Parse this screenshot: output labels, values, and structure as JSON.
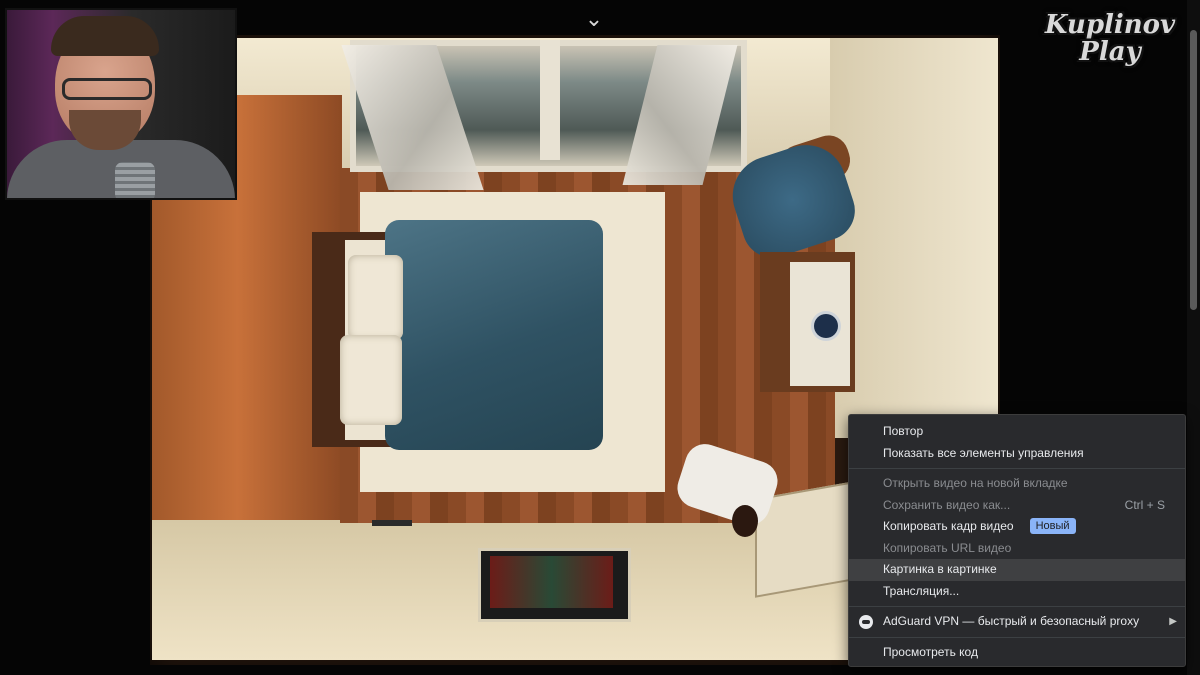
{
  "video": {
    "collapse_icon": "chevron-down-icon",
    "collapse_glyph": "⌄"
  },
  "webcam": {
    "description": "streamer-webcam"
  },
  "logo": {
    "line1": "Kuplinov",
    "line2": "Play"
  },
  "context_menu": {
    "items": [
      {
        "label": "Повтор",
        "enabled": true
      },
      {
        "label": "Показать все элементы управления",
        "enabled": true
      },
      {
        "label": "Открыть видео на новой вкладке",
        "enabled": false
      },
      {
        "label": "Сохранить видео как...",
        "shortcut": "Ctrl + S",
        "enabled": false
      },
      {
        "label": "Копировать кадр видео",
        "badge": "Новый",
        "enabled": true
      },
      {
        "label": "Копировать URL видео",
        "enabled": false
      },
      {
        "label": "Картинка в картинке",
        "enabled": true,
        "highlighted": true
      },
      {
        "label": "Трансляция...",
        "enabled": true
      },
      {
        "label": "AdGuard VPN — быстрый и безопасный proxy",
        "enabled": true,
        "icon": "adguard-icon",
        "submenu": true
      },
      {
        "label": "Просмотреть код",
        "enabled": true
      }
    ]
  },
  "colors": {
    "menu_bg": "#292a2d",
    "menu_text": "#e8eaed",
    "badge": "#8ab4f8"
  }
}
